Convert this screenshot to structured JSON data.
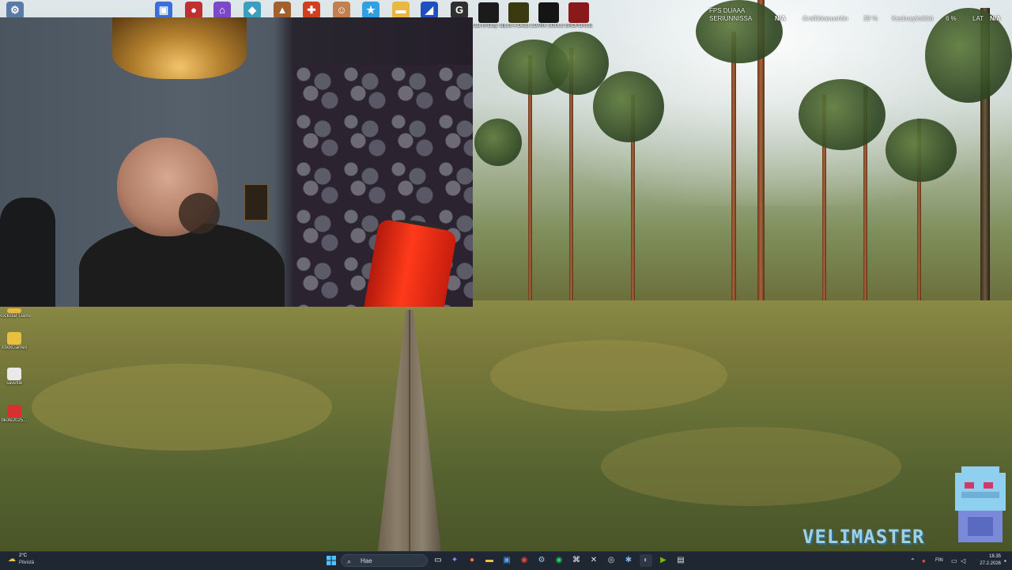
{
  "top_icons": [
    {
      "name": "settings-app-icon",
      "color": "#5a7aa8",
      "glyph": "⚙"
    },
    {
      "name": "game-icon-1",
      "color": "#3a6fd8",
      "glyph": "▣"
    },
    {
      "name": "game-icon-2",
      "color": "#c03030",
      "glyph": "●"
    },
    {
      "name": "twitch-icon",
      "color": "#7a48c8",
      "glyph": "⌂"
    },
    {
      "name": "game-icon-3",
      "color": "#3aa0c0",
      "glyph": "◆"
    },
    {
      "name": "game-icon-4",
      "color": "#a06030",
      "glyph": "▲"
    },
    {
      "name": "game-icon-5",
      "color": "#d04020",
      "glyph": "✚"
    },
    {
      "name": "game-icon-6",
      "color": "#c08050",
      "glyph": "☺"
    },
    {
      "name": "game-icon-7",
      "color": "#30a0e0",
      "glyph": "★"
    },
    {
      "name": "folder-icon",
      "color": "#e8b840",
      "glyph": "▬"
    },
    {
      "name": "game-icon-8",
      "color": "#2050c0",
      "glyph": "◢"
    },
    {
      "name": "game-icon-9",
      "color": "#303030",
      "glyph": "G"
    }
  ],
  "top_labeled_icons": [
    {
      "label": "Call of Duty: Black Ops III",
      "name": "blackops3-icon",
      "color": "#1b1b1b"
    },
    {
      "label": "Left 4 Dead 2",
      "name": "left4dead2-icon",
      "color": "#3a3a10"
    },
    {
      "label": "DARK SOULS",
      "name": "darksouls-icon",
      "color": "#151515"
    },
    {
      "label": "BROFORCE",
      "name": "broforce-icon",
      "color": "#8a1a1a"
    }
  ],
  "left_icons": [
    {
      "label": "Rockstar Games",
      "name": "rockstar-games-folder-icon",
      "color": "#e8b840"
    },
    {
      "label": "XboxGames",
      "name": "xboxgames-folder-icon",
      "color": "#e8c040"
    },
    {
      "label": "savefile",
      "name": "savefile-icon",
      "color": "#e9e9e9"
    },
    {
      "label": "tiliote2025...",
      "name": "pdf-icon",
      "color": "#d83030"
    }
  ],
  "overlay": {
    "fps_label": "FPS DUAAA",
    "fps_sub": "SERIUNNISSA",
    "na1": "N/A",
    "gpu_label": "Grafiikkasuoritin",
    "gpu_value": "39 %",
    "cpu_label": "Keskusyksikkö",
    "cpu_value": "6 %",
    "lat_label": "LAT",
    "na2": "N/A"
  },
  "brand": "VELIMASTER",
  "taskbar": {
    "weather_temp": "2°C",
    "weather_desc": "Pilvistä",
    "search_placeholder": "Hae",
    "lang": "FIN",
    "time": "18.35",
    "date": "27.2.2026"
  }
}
